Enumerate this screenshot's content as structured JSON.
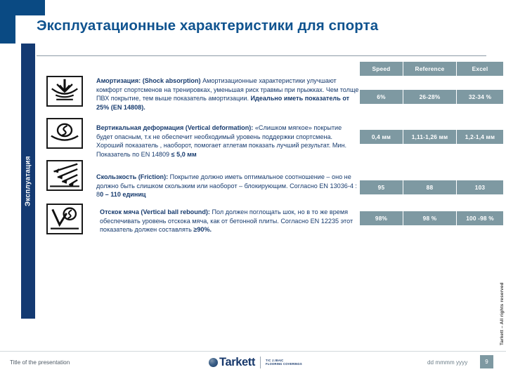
{
  "slide": {
    "title": "Эксплуатационные характеристики  для спорта",
    "side_tab_label": "Эксплуатация",
    "copyright": "Tarkett – All rights reserved"
  },
  "icons": {
    "shock": "shock-absorption-icon",
    "vertical_deformation": "vertical-deformation-icon",
    "friction": "friction-icon",
    "ball_rebound": "ball-rebound-icon"
  },
  "content": {
    "shock_absorption": {
      "heading": "Амортизация: (Shock absorption)",
      "body": " Амортизационные характеристики улучшают комфорт спортсменов на тренировках, уменьшая риск травмы при прыжках. Чем толще ПВХ покрытие, тем выше показатель амортизации. ",
      "emphasis": "Идеально иметь показатель от 25% (EN 14808)."
    },
    "vertical_deformation": {
      "heading": "Вертикальная деформация (Vertical deformation):",
      "body": " «Слишком мягкое» покрытие будет опасным, т.к не обеспечит необходимый уровень поддержки спортсмена. Хороший показатель , наоборот, помогает атлетам показать лучший результат.  Мин. Показатель по EN 14809 ",
      "emphasis": "≤ 5,0 мм"
    },
    "friction": {
      "heading": "Скользкость (Friction):",
      "body": "  Покрытие должно иметь оптимальное соотношение – оно не должно быть слишком скользким или  наоборот – блокирующим. Согласно EN 13036-4 : 8",
      "emphasis": "0 – 110 единиц"
    },
    "ball_rebound": {
      "heading": "Отскок мяча (Vertical ball rebound):",
      "body": "  Пол должен поглощать шок, но в то же время обеспечивать уровень отскока мяча, как от бетонной плиты. Согласно EN 12235 этот показатель  должен составлять ",
      "emphasis": "≥90%."
    }
  },
  "table": {
    "headers": [
      "Speed",
      "Reference",
      "Excel"
    ],
    "rows": [
      {
        "name": "shock-absorption-row",
        "cells": [
          "6%",
          "26-28%",
          "32-34 %"
        ]
      },
      {
        "name": "vertical-deformation-row",
        "cells": [
          "0,4 мм",
          "1,11-1,26 мм",
          "1,2-1,4 мм"
        ]
      },
      {
        "name": "friction-row",
        "cells": [
          "95",
          "88",
          "103"
        ]
      },
      {
        "name": "ball-rebound-row",
        "cells": [
          "98%",
          "98 %",
          "100 -98 %"
        ]
      }
    ]
  },
  "footer": {
    "presentation_title": "Title of the presentation",
    "date": "dd mmmm yyyy",
    "page_number": "9",
    "logo_text": "Tarkett",
    "logo_tagline_line1": "T!C J.!BAIC",
    "logo_tagline_line2": "FLOORING COVERINGS"
  },
  "colors": {
    "brand_blue": "#0a4a83",
    "title_blue": "#0f538f",
    "text_blue": "#173b6e",
    "tab_navy": "#143a72",
    "table_cell": "#7e99a2"
  }
}
